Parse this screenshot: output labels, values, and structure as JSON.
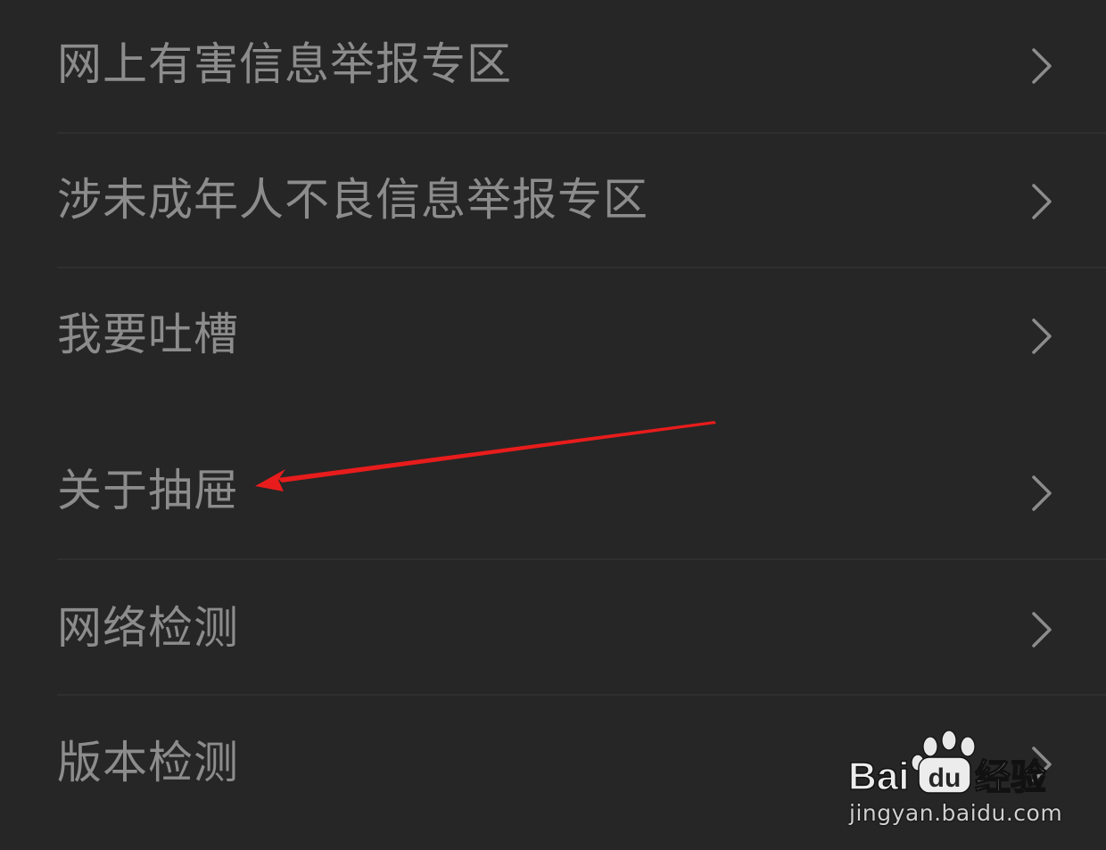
{
  "menu": {
    "items": [
      {
        "label": "网上有害信息举报专区"
      },
      {
        "label": "涉未成年人不良信息举报专区"
      },
      {
        "label": "我要吐槽"
      },
      {
        "label": "关于抽屉"
      },
      {
        "label": "网络检测"
      },
      {
        "label": "版本检测"
      }
    ]
  },
  "icons": {
    "chevron": "chevron-right-icon",
    "annotation": "red-arrow-annotation",
    "watermark": "baidu-jingyan-logo"
  },
  "colors": {
    "background": "#262626",
    "text": "#8c8c8c",
    "chevron": "#8c8c8c",
    "divider": "#2f2f2f",
    "annotation": "#e81c1c"
  },
  "watermark": {
    "brand": "Bai",
    "brand_tail": "du",
    "product": "经验",
    "url": "jingyan.baidu.com"
  }
}
